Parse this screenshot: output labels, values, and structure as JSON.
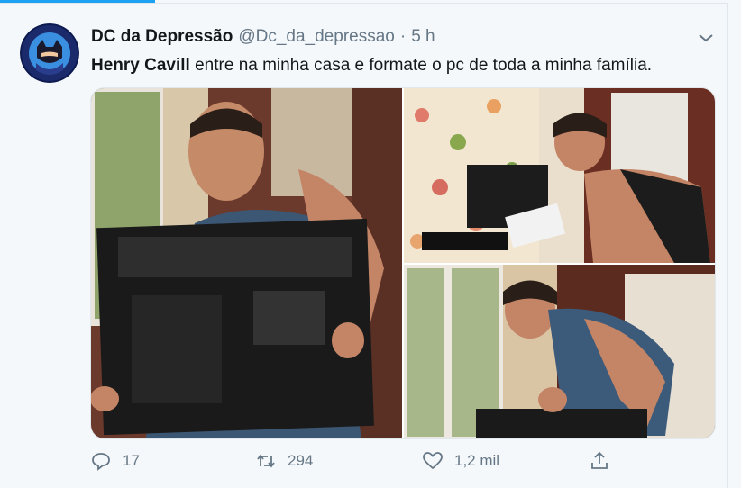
{
  "tweet": {
    "display_name": "DC da Depressão",
    "handle": "@Dc_da_depressao",
    "separator": "·",
    "time": "5 h",
    "text_bold": "Henry Cavill",
    "text_rest": " entre na minha casa e formate o pc de toda a minha família.",
    "avatar_text": "DC DA DEPRESSÃO"
  },
  "actions": {
    "reply_count": "17",
    "retweet_count": "294",
    "like_count": "1,2 mil"
  },
  "icons": [
    "chevron-down-icon",
    "reply-icon",
    "retweet-icon",
    "like-icon",
    "share-icon"
  ],
  "colors": {
    "accent": "#1da1f2",
    "muted_text": "#657786",
    "primary_text": "#14171a",
    "background": "#f5f8fa"
  }
}
